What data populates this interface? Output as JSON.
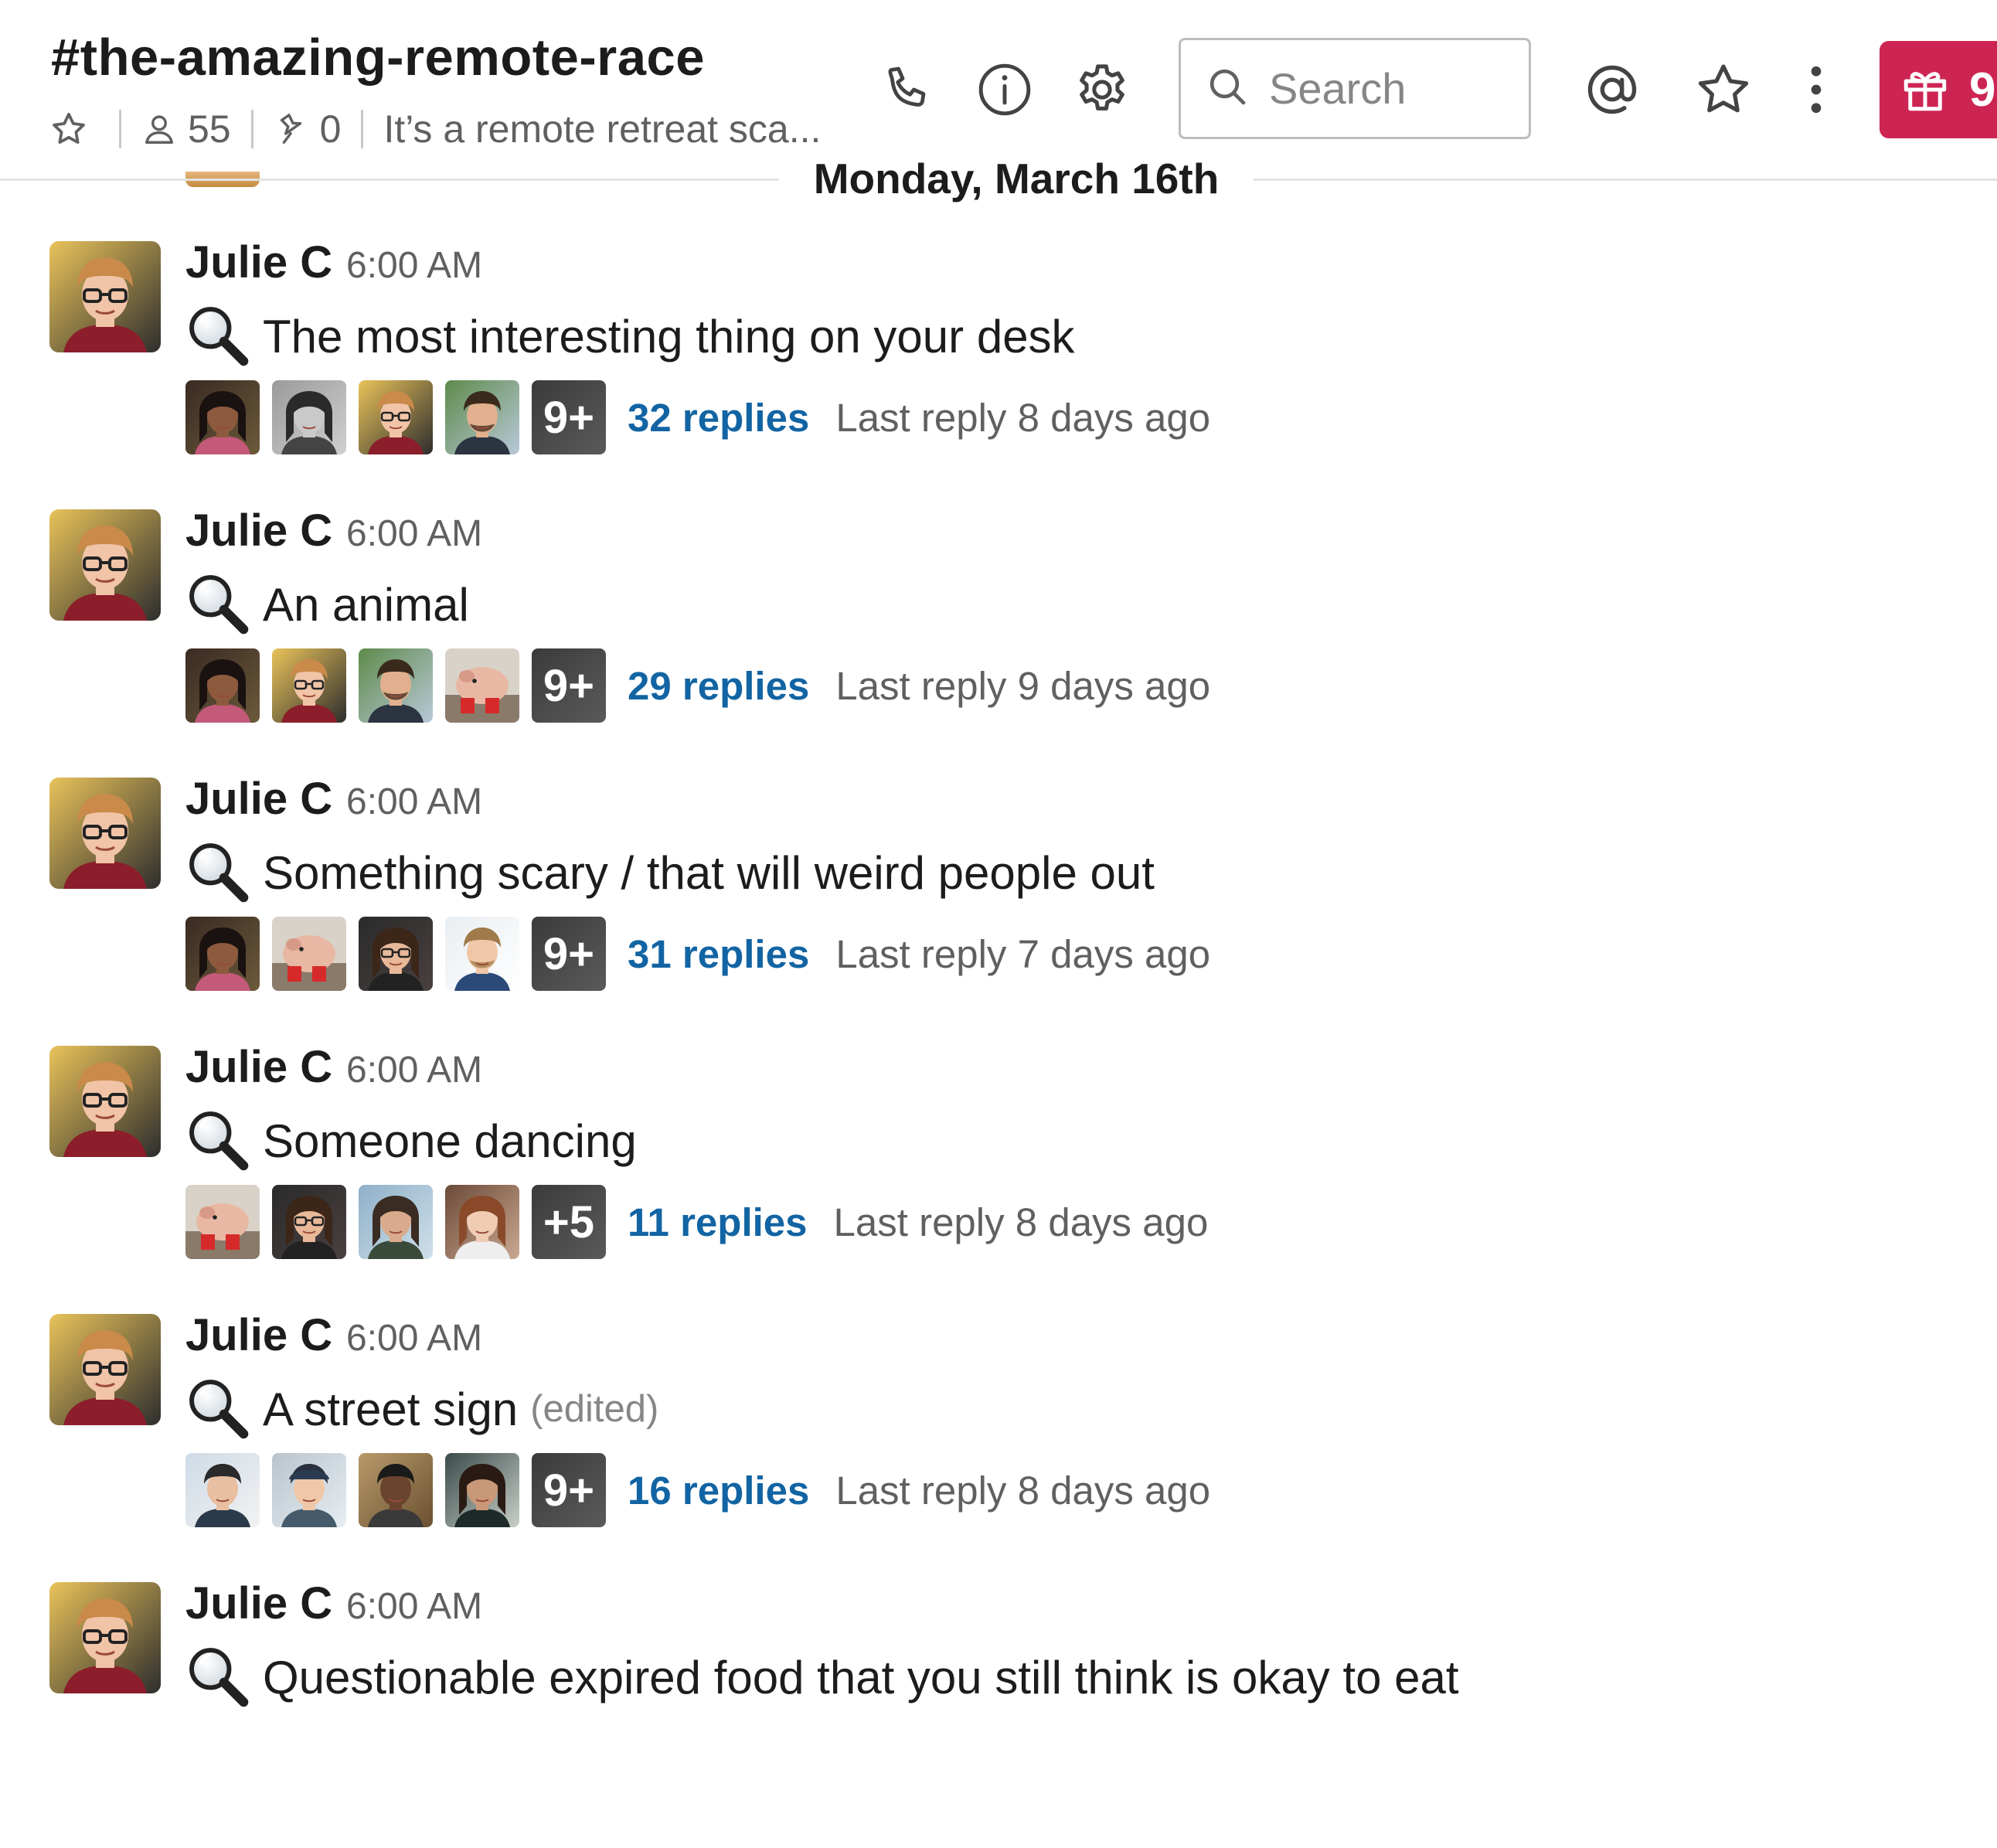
{
  "header": {
    "channel_name": "#the-amazing-remote-race",
    "member_count": "55",
    "pinned_count": "0",
    "topic": "It’s a remote retreat sca...",
    "search_placeholder": "Search",
    "gift_count": "9"
  },
  "date_divider": "Monday, March 16th",
  "messages": [
    {
      "author": "Julie C",
      "time": "6:00 AM",
      "text": "The most interesting thing on your desk",
      "edited": "",
      "reply_avatars": [
        "avatar-woman-dark-hair",
        "avatar-woman-bw",
        "avatar-julie",
        "avatar-man-outdoors"
      ],
      "more": "9+",
      "replies": "32 replies",
      "last_reply": "Last reply 8 days ago"
    },
    {
      "author": "Julie C",
      "time": "6:00 AM",
      "text": "An animal",
      "edited": "",
      "reply_avatars": [
        "avatar-woman-dark-hair",
        "avatar-julie",
        "avatar-man-outdoors",
        "avatar-pig-toy"
      ],
      "more": "9+",
      "replies": "29 replies",
      "last_reply": "Last reply 9 days ago"
    },
    {
      "author": "Julie C",
      "time": "6:00 AM",
      "text": "Something scary / that will weird people out",
      "edited": "",
      "reply_avatars": [
        "avatar-woman-dark-hair",
        "avatar-pig-toy",
        "avatar-woman-glasses",
        "avatar-man-suit"
      ],
      "more": "9+",
      "replies": "31 replies",
      "last_reply": "Last reply 7 days ago"
    },
    {
      "author": "Julie C",
      "time": "6:00 AM",
      "text": "Someone dancing",
      "edited": "",
      "reply_avatars": [
        "avatar-pig-toy",
        "avatar-woman-glasses",
        "avatar-woman-outdoors",
        "avatar-woman-auburn"
      ],
      "more": "+5",
      "replies": "11 replies",
      "last_reply": "Last reply 8 days ago"
    },
    {
      "author": "Julie C",
      "time": "6:00 AM",
      "text": "A street sign",
      "edited": "(edited)",
      "reply_avatars": [
        "avatar-man-smiling",
        "avatar-woman-cap",
        "avatar-man-dark",
        "avatar-person-indoors"
      ],
      "more": "9+",
      "replies": "16 replies",
      "last_reply": "Last reply 8 days ago"
    },
    {
      "author": "Julie C",
      "time": "6:00 AM",
      "text": "Questionable expired food that you still think is okay to eat",
      "edited": "",
      "reply_avatars": [],
      "more": "",
      "replies": "",
      "last_reply": ""
    }
  ]
}
